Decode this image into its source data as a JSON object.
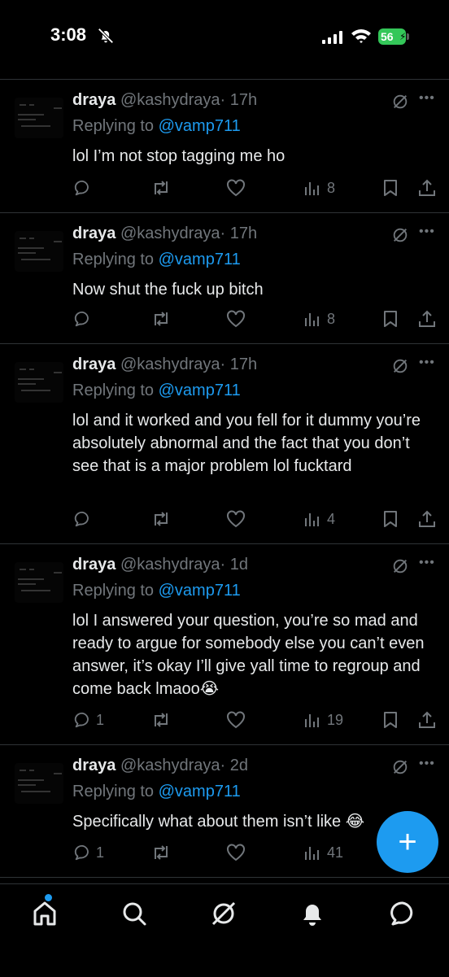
{
  "status_bar": {
    "time": "3:08",
    "battery": "56"
  },
  "tweets": [
    {
      "name": "draya",
      "handle": "@kashydraya",
      "time": "· 17h",
      "replying_prefix": "Replying to",
      "replying_to": "@vamp711",
      "text": "lol I’m not stop tagging me ho",
      "replies": "",
      "views": "8"
    },
    {
      "name": "draya",
      "handle": "@kashydraya",
      "time": "· 17h",
      "replying_prefix": "Replying to",
      "replying_to": "@vamp711",
      "text": "Now shut the fuck up bitch",
      "replies": "",
      "views": "8"
    },
    {
      "name": "draya",
      "handle": "@kashydraya",
      "time": "· 17h",
      "replying_prefix": "Replying to",
      "replying_to": "@vamp711",
      "text": "lol and it worked and you fell for it dummy you’re absolutely abnormal and the fact that you don’t see that is a major problem lol fucktard",
      "replies": "",
      "views": "4"
    },
    {
      "name": "draya",
      "handle": "@kashydraya",
      "time": "· 1d",
      "replying_prefix": "Replying to",
      "replying_to": "@vamp711",
      "text": "lol I answered your question, you’re so mad and ready to argue for somebody else you can’t even answer, it’s okay I’ll give yall time to regroup and come back lmaoo😭",
      "replies": "1",
      "views": "19"
    },
    {
      "name": "draya",
      "handle": "@kashydraya",
      "time": "· 2d",
      "replying_prefix": "Replying to",
      "replying_to": "@vamp711",
      "text": "Specifically what about them isn’t like 😂",
      "replies": "1",
      "views": "41"
    }
  ],
  "fab": {
    "label": "+"
  },
  "nav": [
    "home-icon",
    "search-icon",
    "grok-icon",
    "notifications-icon",
    "messages-icon"
  ]
}
